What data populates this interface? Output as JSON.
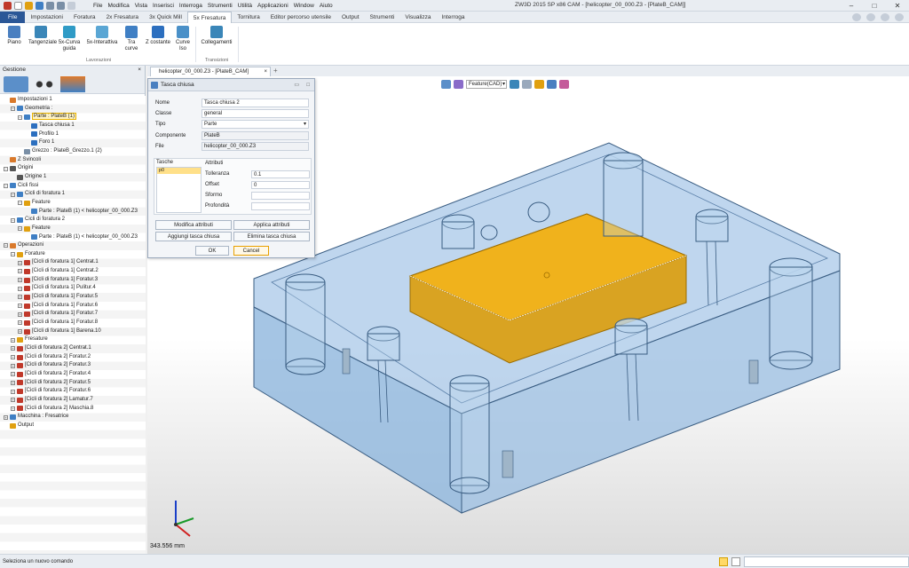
{
  "app": {
    "window_title": "ZW3D 2015 SP x86    CAM - [helicopter_00_000.Z3 - [PlateB_CAM]]",
    "menu": [
      "File",
      "Modifica",
      "Vista",
      "Inserisci",
      "Interroga",
      "Strumenti",
      "Utilità",
      "Applicazioni",
      "Window",
      "Aiuto"
    ]
  },
  "ribbon": {
    "tabs": [
      "File",
      "Impostazioni",
      "Foratura",
      "2x Fresatura",
      "3x Quick Mill",
      "5x Fresatura",
      "Tornitura",
      "Editor percorso utensile",
      "Output",
      "Strumenti",
      "Visualizza",
      "Interroga"
    ],
    "active_tab": "5x Fresatura",
    "buttons": [
      "Piano",
      "Tangenziale",
      "5x-Curva guida",
      "5x-Interattiva",
      "Tra curve",
      "Z costante",
      "Curve Iso",
      "Collegamenti"
    ],
    "groups": [
      "Lavorazioni",
      "Transizioni"
    ]
  },
  "panel": {
    "title": "Gestione",
    "close": "×",
    "tree": [
      {
        "label": "Impostazioni 1",
        "level": 0,
        "exp": "",
        "icon": "settings-icon",
        "color": "#d9792b"
      },
      {
        "label": "Geometria :",
        "level": 1,
        "exp": "−",
        "icon": "geometry-icon",
        "color": "#3f7fc4"
      },
      {
        "label": "Parte : PlateB (1)",
        "level": 2,
        "exp": "−",
        "icon": "part-icon",
        "color": "#3f7fc4",
        "selected": true
      },
      {
        "label": "Tasca chiusa 1",
        "level": 3,
        "exp": "",
        "icon": "pocket-icon",
        "color": "#2c6fbf"
      },
      {
        "label": "Profilo 1",
        "level": 3,
        "exp": "",
        "icon": "profile-icon",
        "color": "#2c6fbf"
      },
      {
        "label": "Foro 1",
        "level": 3,
        "exp": "",
        "icon": "hole-icon",
        "color": "#2c6fbf"
      },
      {
        "label": "Grezzo : PlateB_Grezzo.1 (2)",
        "level": 2,
        "exp": "",
        "icon": "stock-icon",
        "color": "#7a8fa6"
      },
      {
        "label": "Z Svincoli",
        "level": 0,
        "exp": "",
        "icon": "clearance-icon",
        "color": "#d9792b"
      },
      {
        "label": "Origini",
        "level": 0,
        "exp": "−",
        "icon": "origin-icon",
        "color": "#555555"
      },
      {
        "label": "Origine 1",
        "level": 1,
        "exp": "",
        "icon": "origin-icon",
        "color": "#555555"
      },
      {
        "label": "Cicli fissi",
        "level": 0,
        "exp": "−",
        "icon": "cycles-icon",
        "color": "#3f7fc4"
      },
      {
        "label": "Cicli di foratura 1",
        "level": 1,
        "exp": "−",
        "icon": "drill-cycle-icon",
        "color": "#3f7fc4"
      },
      {
        "label": "Feature",
        "level": 2,
        "exp": "−",
        "icon": "feature-icon",
        "color": "#e0a010"
      },
      {
        "label": "Parte : PlateB (1) < helicopter_00_000.Z3",
        "level": 3,
        "exp": "",
        "icon": "part-icon",
        "color": "#3f7fc4"
      },
      {
        "label": "Cicli di foratura 2",
        "level": 1,
        "exp": "−",
        "icon": "drill-cycle-icon",
        "color": "#3f7fc4"
      },
      {
        "label": "Feature",
        "level": 2,
        "exp": "−",
        "icon": "feature-icon",
        "color": "#e0a010"
      },
      {
        "label": "Parte : PlateB (1) < helicopter_00_000.Z3",
        "level": 3,
        "exp": "",
        "icon": "part-icon",
        "color": "#3f7fc4"
      },
      {
        "label": "Operazioni",
        "level": 0,
        "exp": "−",
        "icon": "operations-icon",
        "color": "#d9792b"
      },
      {
        "label": "Forature",
        "level": 1,
        "exp": "−",
        "icon": "folder-icon",
        "color": "#e0a010"
      },
      {
        "label": "[Cicli di foratura 1] Centrat.1",
        "level": 2,
        "exp": "+",
        "icon": "drill-op-icon",
        "color": "#c0392b"
      },
      {
        "label": "[Cicli di foratura 1] Centrat.2",
        "level": 2,
        "exp": "+",
        "icon": "drill-op-icon",
        "color": "#c0392b"
      },
      {
        "label": "[Cicli di foratura 1] Foratur.3",
        "level": 2,
        "exp": "+",
        "icon": "drill-op-icon",
        "color": "#c0392b"
      },
      {
        "label": "[Cicli di foratura 1] Pulitur.4",
        "level": 2,
        "exp": "+",
        "icon": "drill-op-icon",
        "color": "#c0392b"
      },
      {
        "label": "[Cicli di foratura 1] Foratur.5",
        "level": 2,
        "exp": "+",
        "icon": "drill-op-icon",
        "color": "#c0392b"
      },
      {
        "label": "[Cicli di foratura 1] Foratur.6",
        "level": 2,
        "exp": "+",
        "icon": "drill-op-icon",
        "color": "#c0392b"
      },
      {
        "label": "[Cicli di foratura 1] Foratur.7",
        "level": 2,
        "exp": "+",
        "icon": "drill-op-icon",
        "color": "#c0392b"
      },
      {
        "label": "[Cicli di foratura 1] Foratur.8",
        "level": 2,
        "exp": "+",
        "icon": "drill-op-icon",
        "color": "#c0392b"
      },
      {
        "label": "[Cicli di foratura 1] Barena.10",
        "level": 2,
        "exp": "+",
        "icon": "drill-op-icon",
        "color": "#c0392b"
      },
      {
        "label": "Fresature",
        "level": 1,
        "exp": "+",
        "icon": "folder-icon",
        "color": "#e0a010"
      },
      {
        "label": "[Cicli di foratura 2] Centrat.1",
        "level": 1,
        "exp": "+",
        "icon": "drill-op-icon",
        "color": "#c0392b"
      },
      {
        "label": "[Cicli di foratura 2] Foratur.2",
        "level": 1,
        "exp": "+",
        "icon": "drill-op-icon",
        "color": "#c0392b"
      },
      {
        "label": "[Cicli di foratura 2] Foratur.3",
        "level": 1,
        "exp": "+",
        "icon": "drill-op-icon",
        "color": "#c0392b"
      },
      {
        "label": "[Cicli di foratura 2] Foratur.4",
        "level": 1,
        "exp": "+",
        "icon": "drill-op-icon",
        "color": "#c0392b"
      },
      {
        "label": "[Cicli di foratura 2] Foratur.5",
        "level": 1,
        "exp": "+",
        "icon": "drill-op-icon",
        "color": "#c0392b"
      },
      {
        "label": "[Cicli di foratura 2] Foratur.6",
        "level": 1,
        "exp": "+",
        "icon": "drill-op-icon",
        "color": "#c0392b"
      },
      {
        "label": "[Cicli di foratura 2] Lamatur.7",
        "level": 1,
        "exp": "+",
        "icon": "drill-op-icon",
        "color": "#c0392b"
      },
      {
        "label": "[Cicli di foratura 2] Maschia.8",
        "level": 1,
        "exp": "+",
        "icon": "drill-op-icon",
        "color": "#c0392b"
      },
      {
        "label": "Macchina : Fresatrice",
        "level": 0,
        "exp": "+",
        "icon": "machine-icon",
        "color": "#3f7fc4"
      },
      {
        "label": "Output",
        "level": 0,
        "exp": "",
        "icon": "output-icon",
        "color": "#e0a010"
      }
    ]
  },
  "document": {
    "tab_label": "helicopter_00_000.Z3 - [PlateB_CAM]",
    "close": "×",
    "new_tab": "+",
    "filter_value": "Feature(CAD)",
    "measure": "343.556 mm"
  },
  "dialog": {
    "title": "Tasca chiusa",
    "fields": [
      {
        "label": "Nome",
        "value": "Tasca chiusa 2",
        "kind": "input"
      },
      {
        "label": "Classe",
        "value": "general",
        "kind": "input"
      },
      {
        "label": "Tipo",
        "value": "Parte",
        "kind": "dropdown"
      },
      {
        "label": "Componente",
        "value": "PlateB",
        "kind": "readonly"
      },
      {
        "label": "File",
        "value": "helicopter_00_000.Z3",
        "kind": "readonly"
      }
    ],
    "tasche_label": "Tasche",
    "tasche_items": [
      "p0"
    ],
    "attributi_label": "Attributi",
    "attributes": [
      {
        "label": "Tolleranza",
        "value": "0.1"
      },
      {
        "label": "Offset",
        "value": "0"
      },
      {
        "label": "Sformo",
        "value": ""
      },
      {
        "label": "Profondità",
        "value": ""
      }
    ],
    "buttons": {
      "modify": "Modifica attributi",
      "apply": "Applica attributi",
      "add": "Aggiungi tasca chiusa",
      "delete": "Elimina tasca chiusa",
      "ok": "OK",
      "cancel": "Cancel"
    }
  },
  "status": {
    "text": "Seleziona un nuovo comando"
  }
}
